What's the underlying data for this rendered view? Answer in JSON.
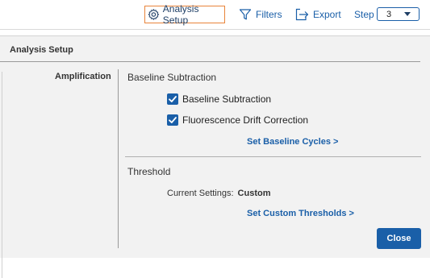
{
  "toolbar": {
    "analysis_setup": {
      "label": "Analysis Setup",
      "icon": "gear-icon"
    },
    "filters": {
      "label": "Filters",
      "icon": "filter-icon"
    },
    "export": {
      "label": "Export",
      "icon": "export-icon"
    },
    "step": {
      "label": "Step",
      "value": "3"
    }
  },
  "panel": {
    "title": "Analysis Setup",
    "section_label": "Amplification",
    "baseline": {
      "title": "Baseline Subtraction",
      "options": [
        {
          "label": "Baseline Subtraction",
          "checked": true
        },
        {
          "label": "Fluorescence Drift Correction",
          "checked": true
        }
      ],
      "link": "Set Baseline Cycles >"
    },
    "threshold": {
      "title": "Threshold",
      "current_label": "Current Settings:",
      "current_value": "Custom",
      "link": "Set Custom Thresholds >"
    },
    "close_label": "Close"
  },
  "colors": {
    "accent": "#1a5fa8",
    "focus_border": "#e8843a",
    "panel_bg": "#f2f2f2"
  }
}
